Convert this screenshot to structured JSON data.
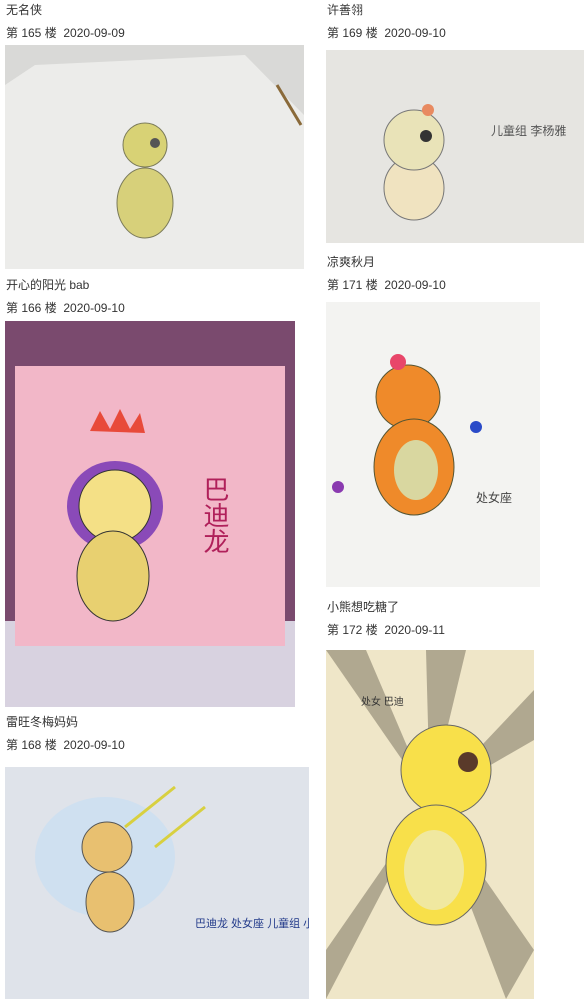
{
  "posts": [
    {
      "author": "无名侠",
      "floor": "第 165 楼",
      "date": "2020-09-09",
      "image_label": ""
    },
    {
      "author": "许善翎",
      "floor": "第 169 楼",
      "date": "2020-09-10",
      "image_label": "儿童组 李杨雅"
    },
    {
      "author": "开心的阳光 bab",
      "floor": "第 166 楼",
      "date": "2020-09-10",
      "image_label": "巴迪龙"
    },
    {
      "author": "凉爽秋月",
      "floor": "第 171 楼",
      "date": "2020-09-10",
      "image_label": "处女座"
    },
    {
      "author": "雷旺冬梅妈妈",
      "floor": "第 168 楼",
      "date": "2020-09-10",
      "image_label": "巴迪龙 处女座 儿童组 小晴霞"
    },
    {
      "author": "小熊想吃糖了",
      "floor": "第 172 楼",
      "date": "2020-09-11",
      "image_label": "处女 巴迪"
    }
  ],
  "colors": {
    "text": "#333333",
    "background": "#ffffff"
  }
}
